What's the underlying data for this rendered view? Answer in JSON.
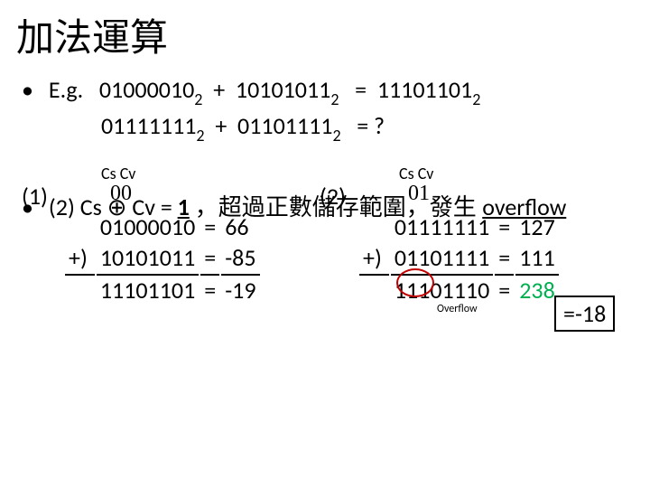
{
  "title": "加法運算",
  "eg": {
    "label": "E.g.",
    "bullet": "•",
    "line1": {
      "a": "01000010",
      "asub": "2",
      "plus": "+",
      "b": "10101011",
      "bsub": "2",
      "eq": "=",
      "r": "11101101",
      "rsub": "2"
    },
    "line2": {
      "a": "01111111",
      "asub": "2",
      "plus": "+",
      "b": "01101111",
      "bsub": "2",
      "eq": "= ?"
    }
  },
  "calc1": {
    "label": "(1)",
    "cscv": "Cs Cv",
    "bits": "0 0",
    "hand": "00",
    "r1": {
      "bin": "01000010",
      "eq": "=",
      "dec": "66"
    },
    "r2": {
      "plus": "+)",
      "bin": "10101011",
      "eq": "=",
      "dec": "-85"
    },
    "r3": {
      "bin": "11101101",
      "eq": "=",
      "dec": "-19"
    }
  },
  "calc2": {
    "label": "(2)",
    "cscv": "Cs Cv",
    "bits": "0 1",
    "hand": "01",
    "r1": {
      "bin": "01111111",
      "eq": "=",
      "dec": "127"
    },
    "r2": {
      "plus": "+)",
      "bin": "01101111",
      "eq": "=",
      "dec": "111"
    },
    "r3": {
      "bin": "11101110",
      "eq": "=",
      "dec": "238"
    }
  },
  "overflow_label": "Overflow",
  "eq18": "=-18",
  "final": {
    "bullet": "•",
    "a": "(2) Cs",
    "op": "⊕",
    "b": "Cv = ",
    "one": "1",
    "t1": "，超過正數儲存範圍，發生 ",
    "t2": "overflow"
  }
}
